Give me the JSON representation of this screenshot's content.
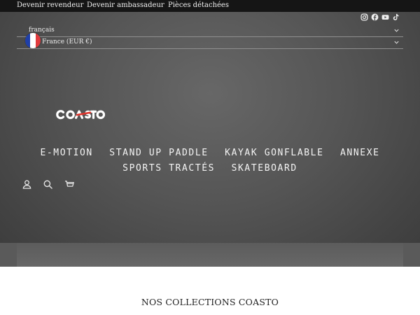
{
  "topbar": {
    "links": [
      "Devenir revendeur",
      "Devenir ambassadeur",
      "Pièces détachées"
    ]
  },
  "social": [
    "instagram-icon",
    "facebook-icon",
    "youtube-icon",
    "tiktok-icon"
  ],
  "language": {
    "value": "français"
  },
  "country": {
    "value": "France (EUR €)"
  },
  "logo": {
    "text": "COASTO"
  },
  "nav": {
    "row1": [
      "E-MOTION",
      "STAND UP PADDLE",
      "KAYAK GONFLABLE",
      "ANNEXE"
    ],
    "row2": [
      "SPORTS TRACTÉS",
      "SKATEBOARD"
    ]
  },
  "utility_icons": [
    "account-icon",
    "search-icon",
    "cart-icon"
  ],
  "collections": {
    "heading": "NOS COLLECTIONS COASTO"
  },
  "colors": {
    "topbar_bg": "#151515",
    "logo_accent": "#e0342c",
    "flag": [
      "#1f3fa8",
      "#ffffff",
      "#e03a3e"
    ]
  }
}
